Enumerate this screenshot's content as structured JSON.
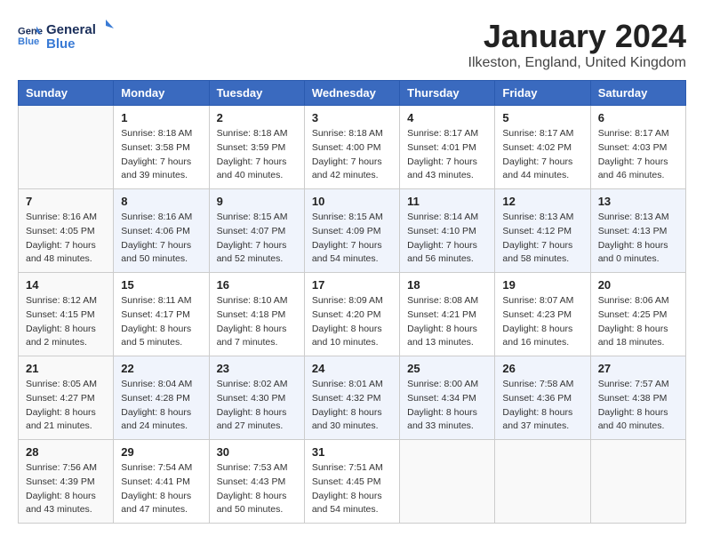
{
  "header": {
    "logo_line1": "General",
    "logo_line2": "Blue",
    "month": "January 2024",
    "location": "Ilkeston, England, United Kingdom"
  },
  "days_of_week": [
    "Sunday",
    "Monday",
    "Tuesday",
    "Wednesday",
    "Thursday",
    "Friday",
    "Saturday"
  ],
  "weeks": [
    [
      {
        "day": "",
        "info": ""
      },
      {
        "day": "1",
        "info": "Sunrise: 8:18 AM\nSunset: 3:58 PM\nDaylight: 7 hours\nand 39 minutes."
      },
      {
        "day": "2",
        "info": "Sunrise: 8:18 AM\nSunset: 3:59 PM\nDaylight: 7 hours\nand 40 minutes."
      },
      {
        "day": "3",
        "info": "Sunrise: 8:18 AM\nSunset: 4:00 PM\nDaylight: 7 hours\nand 42 minutes."
      },
      {
        "day": "4",
        "info": "Sunrise: 8:17 AM\nSunset: 4:01 PM\nDaylight: 7 hours\nand 43 minutes."
      },
      {
        "day": "5",
        "info": "Sunrise: 8:17 AM\nSunset: 4:02 PM\nDaylight: 7 hours\nand 44 minutes."
      },
      {
        "day": "6",
        "info": "Sunrise: 8:17 AM\nSunset: 4:03 PM\nDaylight: 7 hours\nand 46 minutes."
      }
    ],
    [
      {
        "day": "7",
        "info": "Sunrise: 8:16 AM\nSunset: 4:05 PM\nDaylight: 7 hours\nand 48 minutes."
      },
      {
        "day": "8",
        "info": "Sunrise: 8:16 AM\nSunset: 4:06 PM\nDaylight: 7 hours\nand 50 minutes."
      },
      {
        "day": "9",
        "info": "Sunrise: 8:15 AM\nSunset: 4:07 PM\nDaylight: 7 hours\nand 52 minutes."
      },
      {
        "day": "10",
        "info": "Sunrise: 8:15 AM\nSunset: 4:09 PM\nDaylight: 7 hours\nand 54 minutes."
      },
      {
        "day": "11",
        "info": "Sunrise: 8:14 AM\nSunset: 4:10 PM\nDaylight: 7 hours\nand 56 minutes."
      },
      {
        "day": "12",
        "info": "Sunrise: 8:13 AM\nSunset: 4:12 PM\nDaylight: 7 hours\nand 58 minutes."
      },
      {
        "day": "13",
        "info": "Sunrise: 8:13 AM\nSunset: 4:13 PM\nDaylight: 8 hours\nand 0 minutes."
      }
    ],
    [
      {
        "day": "14",
        "info": "Sunrise: 8:12 AM\nSunset: 4:15 PM\nDaylight: 8 hours\nand 2 minutes."
      },
      {
        "day": "15",
        "info": "Sunrise: 8:11 AM\nSunset: 4:17 PM\nDaylight: 8 hours\nand 5 minutes."
      },
      {
        "day": "16",
        "info": "Sunrise: 8:10 AM\nSunset: 4:18 PM\nDaylight: 8 hours\nand 7 minutes."
      },
      {
        "day": "17",
        "info": "Sunrise: 8:09 AM\nSunset: 4:20 PM\nDaylight: 8 hours\nand 10 minutes."
      },
      {
        "day": "18",
        "info": "Sunrise: 8:08 AM\nSunset: 4:21 PM\nDaylight: 8 hours\nand 13 minutes."
      },
      {
        "day": "19",
        "info": "Sunrise: 8:07 AM\nSunset: 4:23 PM\nDaylight: 8 hours\nand 16 minutes."
      },
      {
        "day": "20",
        "info": "Sunrise: 8:06 AM\nSunset: 4:25 PM\nDaylight: 8 hours\nand 18 minutes."
      }
    ],
    [
      {
        "day": "21",
        "info": "Sunrise: 8:05 AM\nSunset: 4:27 PM\nDaylight: 8 hours\nand 21 minutes."
      },
      {
        "day": "22",
        "info": "Sunrise: 8:04 AM\nSunset: 4:28 PM\nDaylight: 8 hours\nand 24 minutes."
      },
      {
        "day": "23",
        "info": "Sunrise: 8:02 AM\nSunset: 4:30 PM\nDaylight: 8 hours\nand 27 minutes."
      },
      {
        "day": "24",
        "info": "Sunrise: 8:01 AM\nSunset: 4:32 PM\nDaylight: 8 hours\nand 30 minutes."
      },
      {
        "day": "25",
        "info": "Sunrise: 8:00 AM\nSunset: 4:34 PM\nDaylight: 8 hours\nand 33 minutes."
      },
      {
        "day": "26",
        "info": "Sunrise: 7:58 AM\nSunset: 4:36 PM\nDaylight: 8 hours\nand 37 minutes."
      },
      {
        "day": "27",
        "info": "Sunrise: 7:57 AM\nSunset: 4:38 PM\nDaylight: 8 hours\nand 40 minutes."
      }
    ],
    [
      {
        "day": "28",
        "info": "Sunrise: 7:56 AM\nSunset: 4:39 PM\nDaylight: 8 hours\nand 43 minutes."
      },
      {
        "day": "29",
        "info": "Sunrise: 7:54 AM\nSunset: 4:41 PM\nDaylight: 8 hours\nand 47 minutes."
      },
      {
        "day": "30",
        "info": "Sunrise: 7:53 AM\nSunset: 4:43 PM\nDaylight: 8 hours\nand 50 minutes."
      },
      {
        "day": "31",
        "info": "Sunrise: 7:51 AM\nSunset: 4:45 PM\nDaylight: 8 hours\nand 54 minutes."
      },
      {
        "day": "",
        "info": ""
      },
      {
        "day": "",
        "info": ""
      },
      {
        "day": "",
        "info": ""
      }
    ]
  ]
}
